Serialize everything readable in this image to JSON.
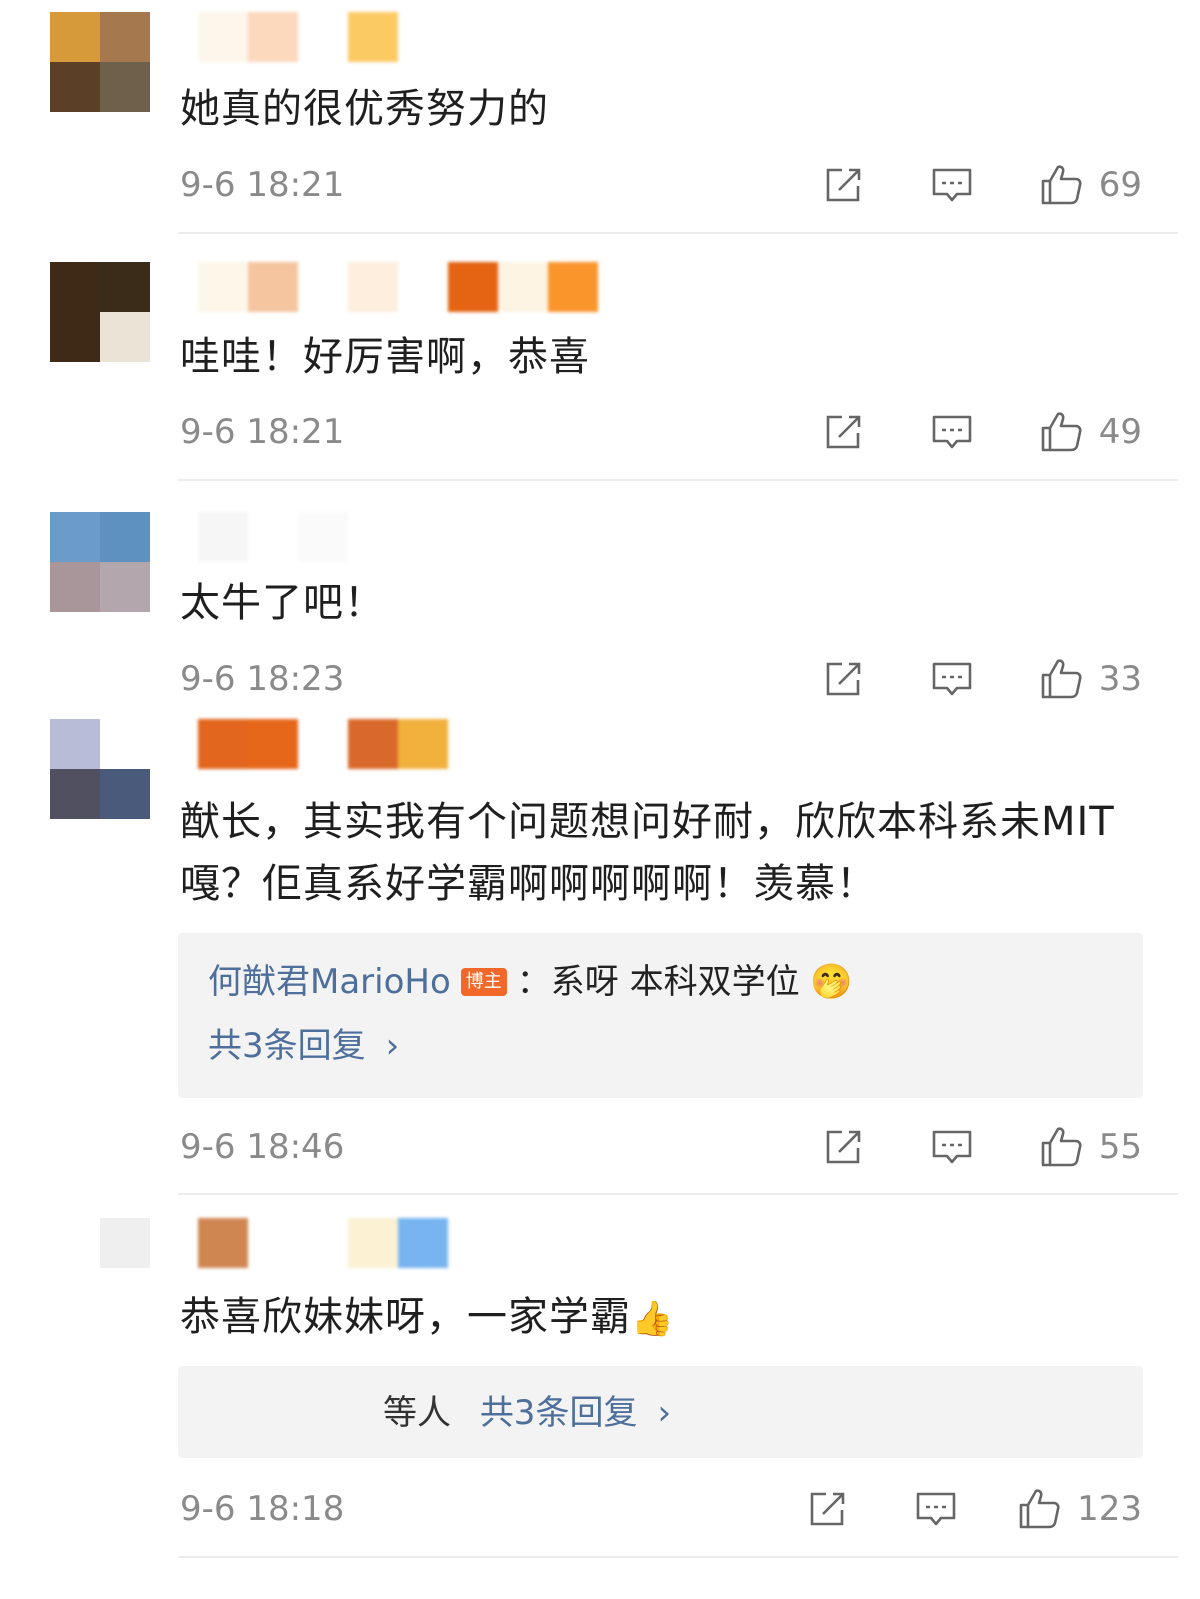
{
  "comments": [
    {
      "text": "她真的很优秀努力的",
      "time": "9-6 18:21",
      "likes": "69",
      "avatar_colors": [
        "#d69a3a",
        "#a5784d",
        "#5b3f26",
        "#6e604a"
      ],
      "name_colors": [
        "#fdf6ea",
        "#fcd8bd",
        "#ffffff",
        "#fcca63"
      ]
    },
    {
      "text": "哇哇！好厉害啊，恭喜",
      "time": "9-6 18:21",
      "likes": "49",
      "avatar_colors": [
        "#3e2a17",
        "#3b2c19",
        "#3e2a17",
        "#ebe4d6"
      ],
      "name_colors": [
        "#fdf7ea",
        "#f4c59f",
        "#ffffff",
        "#fdeedd",
        "#ffffff",
        "#e56413",
        "#fdf4e4",
        "#f9952b"
      ]
    },
    {
      "text": "太牛了吧！",
      "time": "9-6 18:23",
      "likes": "33",
      "avatar_colors": [
        "#6b9bc9",
        "#5e91c0",
        "#a8969a",
        "#b3a6ad"
      ],
      "name_colors": [
        "#f6f6f6",
        "#ffffff",
        "#fafafa"
      ]
    },
    {
      "text": "猷长，其实我有个问题想问好耐，欣欣本科系未MIT嘎？佢真系好学霸啊啊啊啊啊！羡慕！",
      "time": "9-6 18:46",
      "likes": "55",
      "avatar_colors": [
        "#b8bcd6",
        "#ffffff",
        "#505060",
        "#4a5a7a"
      ],
      "name_colors": [
        "#e2661d",
        "#e6661a",
        "#ffffff",
        "#d9692a",
        "#f2b13d"
      ],
      "reply": {
        "author": "何猷君MarioHo",
        "badge": "博主",
        "text": "：系呀 本科双学位",
        "emoji": "🤭",
        "more": "共3条回复"
      }
    },
    {
      "text": "恭喜欣妹妹呀，一家学霸",
      "emoji": "👍",
      "time": "9-6 18:18",
      "likes": "123",
      "avatar_colors": [
        "#ffffff",
        "#efefef",
        "#ffffff",
        "#ffffff"
      ],
      "name_colors": [
        "#cf8651",
        "#ffffff",
        "#ffffff",
        "#fcf1d2",
        "#77b4f0"
      ],
      "reply": {
        "prefix": "等人",
        "more": "共3条回复"
      }
    }
  ],
  "icons": {
    "share": "share-icon",
    "comment": "comment-icon",
    "like": "thumbs-up-icon",
    "chevron": "›"
  },
  "colors": {
    "link": "#4e6f9b",
    "meta": "#8a8a8a",
    "badge": "#f2682a",
    "reply_bg": "#f3f3f3"
  }
}
